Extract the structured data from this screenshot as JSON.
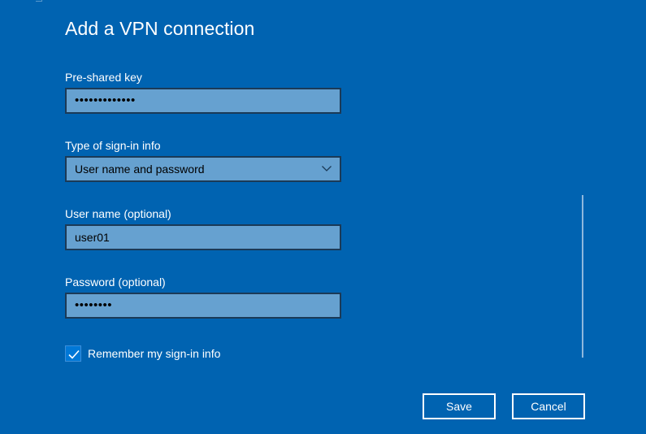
{
  "dialog": {
    "title": "Add a VPN connection"
  },
  "fields": {
    "preshared_key": {
      "label": "Pre-shared key",
      "value": "•••••••••••••"
    },
    "signin_type": {
      "label": "Type of sign-in info",
      "selected": "User name and password"
    },
    "username": {
      "label": "User name (optional)",
      "value": "user01"
    },
    "password": {
      "label": "Password (optional)",
      "value": "••••••••"
    }
  },
  "remember": {
    "label": "Remember my sign-in info",
    "checked": true
  },
  "buttons": {
    "save": "Save",
    "cancel": "Cancel"
  },
  "colors": {
    "background": "#0063B1",
    "field": "#66A1D0",
    "checkbox": "#0078D7"
  },
  "icons": {
    "dropdown": "chevron-down-icon",
    "checkbox": "checkmark-icon"
  }
}
